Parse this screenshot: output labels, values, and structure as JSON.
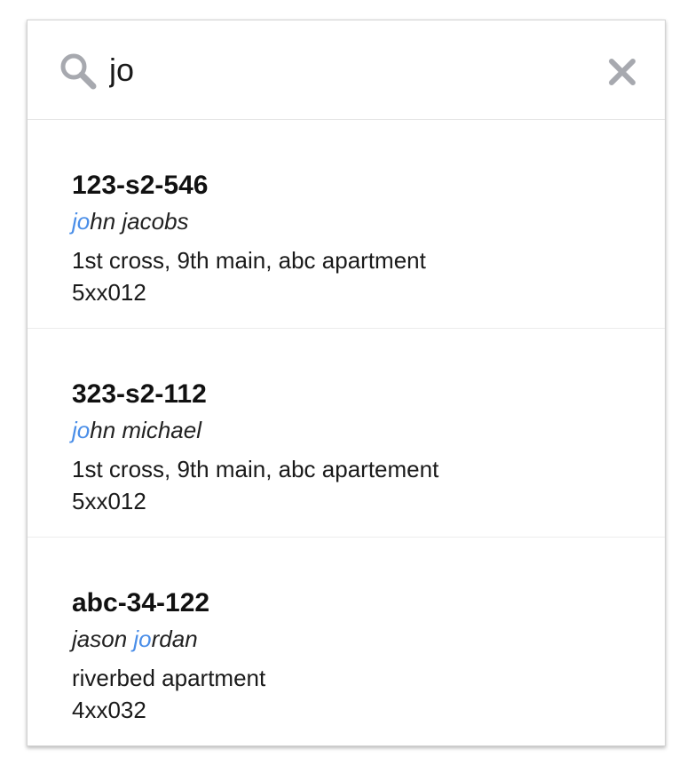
{
  "search": {
    "value": "jo",
    "placeholder": "",
    "search_icon": "search-icon",
    "clear_icon": "close-icon"
  },
  "colors": {
    "highlight": "#4a8ee8",
    "icon": "#a7a9af",
    "border": "#d2d2d2"
  },
  "results": [
    {
      "id": "123-s2-546",
      "name_before": "",
      "name_match": "jo",
      "name_after": "hn jacobs",
      "address": "1st cross, 9th main, abc apartment",
      "code": "5xx012"
    },
    {
      "id": "323-s2-112",
      "name_before": "",
      "name_match": "jo",
      "name_after": "hn michael",
      "address": "1st cross, 9th main, abc apartement",
      "code": "5xx012"
    },
    {
      "id": "abc-34-122",
      "name_before": "jason ",
      "name_match": "jo",
      "name_after": "rdan",
      "address": "riverbed apartment",
      "code": "4xx032"
    }
  ]
}
